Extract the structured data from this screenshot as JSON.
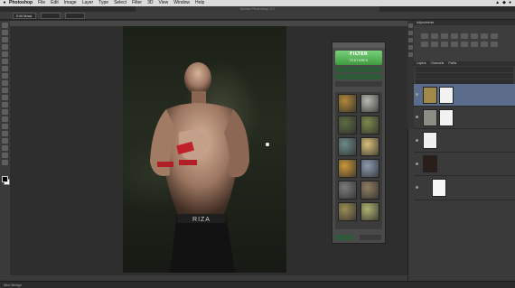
{
  "menubar": {
    "apple": "",
    "app": "Photoshop",
    "items": [
      "File",
      "Edit",
      "Image",
      "Layer",
      "Type",
      "Select",
      "Filter",
      "3D",
      "View",
      "Window",
      "Help"
    ],
    "right": [
      "▲",
      "◆",
      "●"
    ]
  },
  "window_title": "Adobe Photoshop CC",
  "options_bar": {
    "label": "Edit Mask",
    "field": "",
    "field2": ""
  },
  "doc_tab": "",
  "status": "",
  "status2": "Mini Bridge",
  "photo": {
    "trunk_text": "RIZA"
  },
  "texture_panel": {
    "title": "",
    "filter_label": "FILTER",
    "filter_sub": "TEXTURES",
    "row1": "",
    "row2": "",
    "row3": "",
    "apply": "",
    "ok": "",
    "thumb_colors": [
      "#b0883a",
      "#b9b9b2",
      "#5f6b43",
      "#7a8a4a",
      "#6d8a86",
      "#d8c07a",
      "#c9973a",
      "#8b9ab0",
      "#7b7b7b",
      "#8e7d62",
      "#9a8d55",
      "#aeb270"
    ]
  },
  "adjustments": {
    "header": "Adjustments",
    "subheader": ""
  },
  "layers": {
    "tabs": [
      "Layers",
      "Channels",
      "Paths"
    ],
    "blend": "",
    "items": [
      {
        "name": "",
        "selected": true
      },
      {
        "name": "",
        "selected": false
      },
      {
        "name": "",
        "selected": false
      },
      {
        "name": "",
        "selected": false
      },
      {
        "name": "",
        "selected": false
      }
    ]
  },
  "colors": {
    "accent": "#4caf50",
    "selection": "#5b6d8a"
  }
}
